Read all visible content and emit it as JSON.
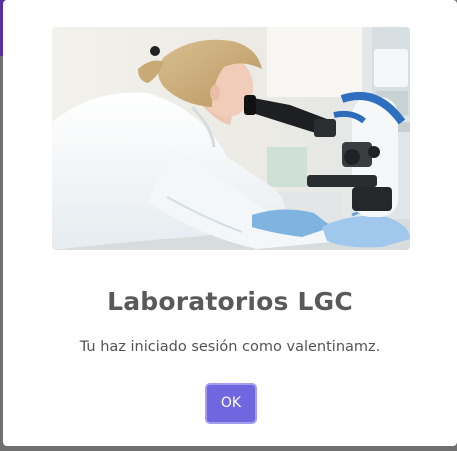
{
  "dialog": {
    "image_subject": "scientist-microscope-photo",
    "title": "Laboratorios LGC",
    "message": "Tu haz iniciado sesión como valentinamz.",
    "confirm_label": "OK"
  },
  "colors": {
    "confirm_button": "#7066e0",
    "confirm_button_focus_ring": "#a49ef0",
    "title_text": "#595959",
    "message_text": "#545454",
    "backdrop": "#707070",
    "backdrop_accent": "#5a2fa3"
  }
}
